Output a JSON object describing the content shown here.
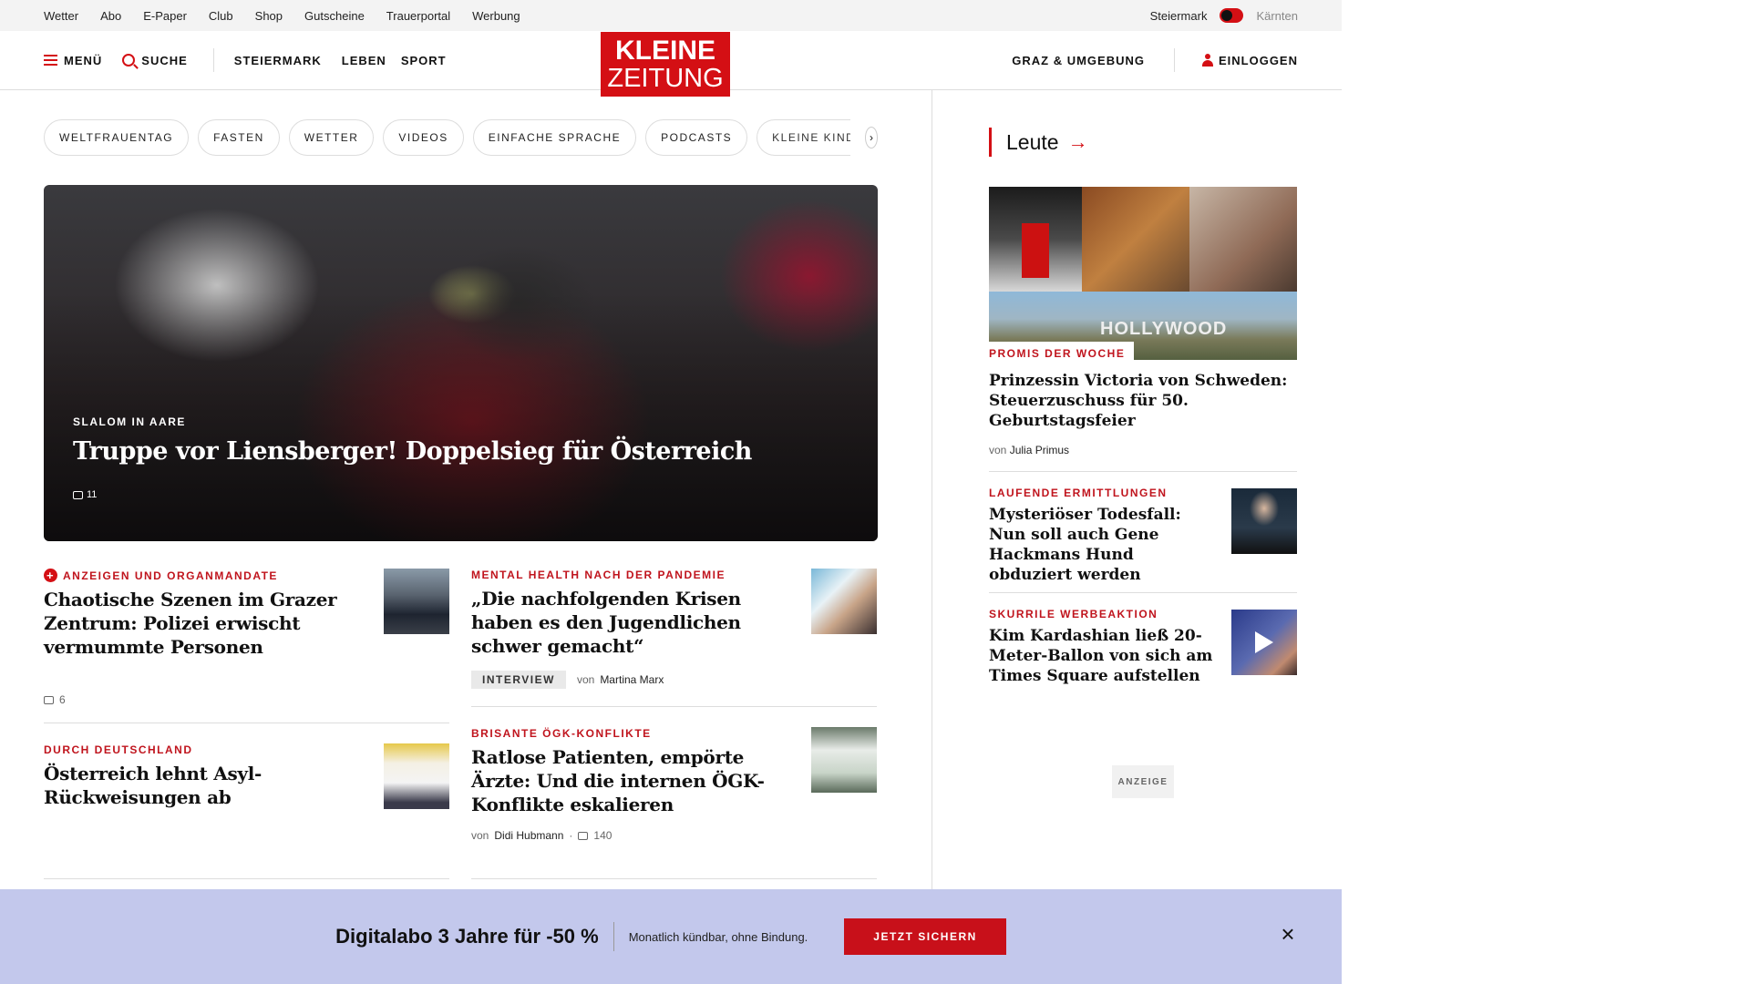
{
  "util_bar": {
    "links": [
      "Wetter",
      "Abo",
      "E-Paper",
      "Club",
      "Shop",
      "Gutscheine",
      "Trauerportal",
      "Werbung"
    ],
    "region_active": "Steiermark",
    "region_inactive": "Kärnten"
  },
  "header": {
    "menu_label": "MENÜ",
    "search_label": "SUCHE",
    "nav": [
      "STEIERMARK",
      "LEBEN",
      "SPORT"
    ],
    "logo_line1": "KLEINE",
    "logo_line2": "ZEITUNG",
    "local_label": "GRAZ & UMGEBUNG",
    "login_label": "EINLOGGEN"
  },
  "tags": [
    "WELTFRAUENTAG",
    "FASTEN",
    "WETTER",
    "VIDEOS",
    "EINFACHE SPRACHE",
    "PODCASTS",
    "KLEINE KINDERZE"
  ],
  "hero": {
    "kicker": "SLALOM IN AARE",
    "title": "Truppe vor Liensberger! Doppelsieg für Österreich",
    "comments": "11"
  },
  "articles_left": [
    {
      "kicker": "ANZEIGEN UND ORGANMANDATE",
      "premium": true,
      "title": "Chaotische Szenen im Grazer Zentrum: Polizei erwischt vermummte Personen",
      "comments": "6"
    },
    {
      "kicker": "DURCH DEUTSCHLAND",
      "title": "Österreich lehnt Asyl-Rückweisungen ab"
    }
  ],
  "articles_right": [
    {
      "kicker": "MENTAL HEALTH NACH DER PANDEMIE",
      "title": "„Die nachfolgenden Krisen haben es den Jugendlichen schwer gemacht“",
      "badge": "INTERVIEW",
      "by": "von",
      "author": "Martina Marx"
    },
    {
      "kicker": "BRISANTE ÖGK-KONFLIKTE",
      "title": "Ratlose Patienten, empörte Ärzte: Und die internen ÖGK-Konflikte eskalieren",
      "by": "von",
      "author": "Didi Hubmann",
      "comments": "140"
    }
  ],
  "sidebar": {
    "heading": "Leute",
    "image_text": "HOLLYWOOD",
    "main": {
      "kicker": "PROMIS DER WOCHE",
      "title": "Prinzessin Victoria von Schweden: Steuerzuschuss für 50. Geburtstagsfeier",
      "by": "von",
      "author": "Julia Primus"
    },
    "items": [
      {
        "kicker": "LAUFENDE ERMITTLUNGEN",
        "title": "Mysteriöser Todesfall: Nun soll auch Gene Hackmans Hund obduziert werden"
      },
      {
        "kicker": "SKURRILE WERBEAKTION",
        "title": "Kim Kardashian ließ 20-Meter-Ballon von sich am Times Square aufstellen"
      }
    ],
    "ad_label": "ANZEIGE"
  },
  "promo": {
    "title": "Digitalabo 3 Jahre für -50 %",
    "subtitle": "Monatlich kündbar, ohne Bindung.",
    "button": "JETZT SICHERN"
  },
  "colors": {
    "brand_red": "#d40f14",
    "promo_bg": "#c3c8ec"
  }
}
